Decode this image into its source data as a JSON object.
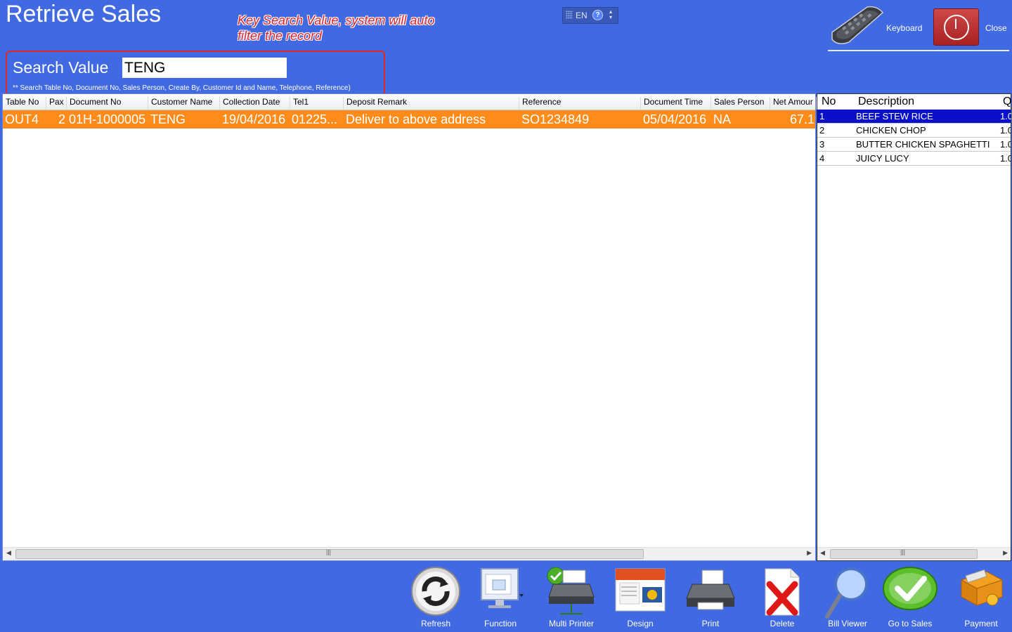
{
  "window": {
    "title": "Retrieve Sales",
    "annotation": "Key Search Value, system will auto filter the record",
    "language_code": "EN"
  },
  "top_buttons": {
    "keyboard_label": "Keyboard",
    "close_label": "Close"
  },
  "search": {
    "label": "Search Value",
    "value": "TENG",
    "hint": "** Search Table No, Document No, Sales Person, Create By, Customer Id and Name, Telephone, Reference)"
  },
  "grid": {
    "columns": [
      "Table No",
      "Pax",
      "Document No",
      "Customer Name",
      "Collection Date",
      "Tel1",
      "Deposit Remark",
      "Reference",
      "Document Time",
      "Sales Person",
      "Net Amour"
    ],
    "rows": [
      {
        "table_no": "OUT4",
        "pax": "2",
        "document_no": "01H-1000005",
        "customer_name": "TENG",
        "collection_date": "19/04/2016",
        "tel1": "01225...",
        "deposit_remark": "Deliver to above address",
        "reference": "SO1234849",
        "document_time": "05/04/2016",
        "sales_person": "NA",
        "net_amount": "67.1"
      }
    ],
    "row_color": "#ff8c1a"
  },
  "detail": {
    "columns": [
      "No",
      "Description",
      "Q"
    ],
    "items": [
      {
        "no": "1",
        "description": "BEEF STEW RICE",
        "qty": "1.0"
      },
      {
        "no": "2",
        "description": "CHICKEN CHOP",
        "qty": "1.0"
      },
      {
        "no": "3",
        "description": "BUTTER CHICKEN SPAGHETTI",
        "qty": "1.0"
      },
      {
        "no": "4",
        "description": "JUICY LUCY",
        "qty": "1.0"
      }
    ],
    "selected_color": "#0a10c8"
  },
  "toolbar": {
    "refresh": "Refresh",
    "function": "Function",
    "multi_printer": "Multi Printer",
    "design": "Design",
    "print": "Print",
    "delete": "Delete",
    "bill_viewer": "Bill Viewer",
    "go_to_sales": "Go to Sales",
    "payment": "Payment"
  },
  "colors": {
    "background": "#4169e1",
    "annotation": "#e02828"
  }
}
